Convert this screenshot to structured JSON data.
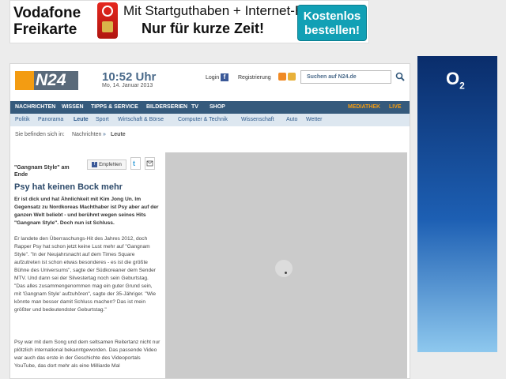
{
  "ad_vodafone": {
    "brand_line1": "Vodafone",
    "brand_line2": "Freikarte",
    "offer_line1": "Mit Startguthaben + Internet-Flat",
    "offer_line2": "Nur für kurze Zeit!",
    "cta_line1": "Kostenlos",
    "cta_line2": "bestellen!"
  },
  "ad_o2": {
    "logo": "O",
    "logo_sub": "2"
  },
  "header": {
    "logo_text": "N24",
    "time": "10:52 Uhr",
    "date": "Mo, 14. Januar 2013",
    "login": "Login",
    "register": "Registrierung",
    "search_placeholder": "Suchen auf N24.de"
  },
  "nav_main": [
    {
      "label": "NACHRICHTEN"
    },
    {
      "label": "WISSEN"
    },
    {
      "label": "TIPPS & SERVICE"
    },
    {
      "label": "BILDERSERIEN"
    },
    {
      "label": "TV"
    },
    {
      "label": "SHOP"
    },
    {
      "label": "MEDIATHEK"
    },
    {
      "label": "LIVE"
    }
  ],
  "nav_sub": [
    {
      "label": "Politik"
    },
    {
      "label": "Panorama"
    },
    {
      "label": "Leute"
    },
    {
      "label": "Sport"
    },
    {
      "label": "Wirtschaft & Börse"
    },
    {
      "label": "Computer & Technik"
    },
    {
      "label": "Wissenschaft"
    },
    {
      "label": "Auto"
    },
    {
      "label": "Wetter"
    }
  ],
  "breadcrumb": {
    "prefix": "Sie befinden sich in:",
    "item1": "Nachrichten",
    "item2": "Leute"
  },
  "article": {
    "kicker": "\"Gangnam Style\" am Ende",
    "share_label": "Empfehlen",
    "headline": "Psy hat keinen Bock mehr",
    "lead": "Er ist dick und hat Ähnlichkeit mit Kim Jong Un. Im Gegensatz zu Nordkoreas Machthaber ist Psy aber auf der ganzen Welt beliebt - und berühmt wegen seines Hits \"Gangnam Style\". Doch nun ist Schluss.",
    "body1": "Er landete den Überraschungs-Hit des Jahres 2012, doch Rapper Psy hat schon jetzt keine Lust mehr auf \"Gangnam Style\". \"In der Neujahrsnacht auf dem Times Square aufzutreten ist schon etwas besonderes - es ist die größte Bühne des Universums\", sagte der Südkoreaner dem Sender MTV. Und dann sei der Silvestertag noch sein Geburtstag. \"Das alles zusammengenommen mag ein guter Grund sein, mit 'Gangnam Style' aufzuhören\", sagte der 35-Jähriger. \"Wie könnte man besser damit Schluss machen? Das ist mein größter und bedeutendster Geburtstag.\"",
    "body2": "Psy war mit dem Song und dem seltsamen Reitertanz nicht nur plötzlich international bekanntgeworden. Das passende Video war auch das erste in der Geschichte des Videoportals YouTube, das dort mehr als eine Milliarde Mal"
  }
}
